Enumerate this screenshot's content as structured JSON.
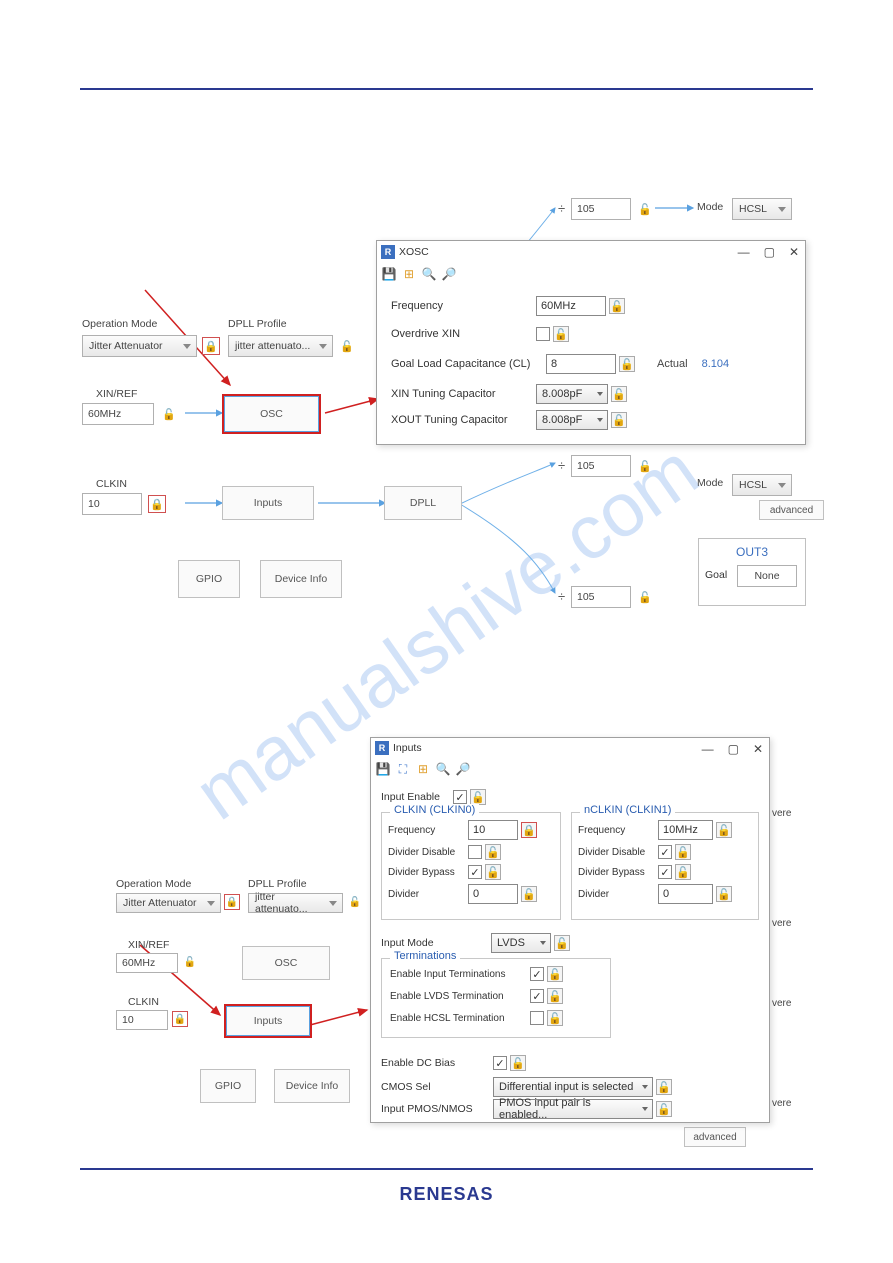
{
  "footer_logo": "RENESAS",
  "watermark": "manualshive.com",
  "diag1": {
    "op_mode_label": "Operation Mode",
    "op_mode_value": "Jitter Attenuator",
    "dpll_profile_label": "DPLL Profile",
    "dpll_profile_value": "jitter attenuato...",
    "xinref_label": "XIN/REF",
    "xinref_value": "60MHz",
    "clkin_label": "CLKIN",
    "clkin_value": "10",
    "osc": "OSC",
    "inputs": "Inputs",
    "dpll": "DPLL",
    "gpio": "GPIO",
    "devinfo": "Device Info",
    "div_sym": "÷",
    "div_val": "105",
    "mode_label": "Mode",
    "mode_value": "HCSL",
    "adv": "advanced",
    "out3": "OUT3",
    "goal": "Goal",
    "goal_val": "None"
  },
  "xosc": {
    "title": "XOSC",
    "freq_lbl": "Frequency",
    "freq_val": "60MHz",
    "over_lbl": "Overdrive XIN",
    "cl_lbl": "Goal Load Capacitance (CL)",
    "cl_val": "8",
    "actual_lbl": "Actual",
    "actual_val": "8.104",
    "xin_lbl": "XIN Tuning Capacitor",
    "xin_val": "8.008pF",
    "xout_lbl": "XOUT Tuning Capacitor",
    "xout_val": "8.008pF"
  },
  "diag2": {
    "op_mode_label": "Operation Mode",
    "op_mode_value": "Jitter Attenuator",
    "dpll_profile_label": "DPLL Profile",
    "dpll_profile_value": "jitter attenuato...",
    "xinref_label": "XIN/REF",
    "xinref_value": "60MHz",
    "clkin_label": "CLKIN",
    "clkin_value": "10",
    "osc": "OSC",
    "inputs": "Inputs",
    "gpio": "GPIO",
    "devinfo": "Device Info",
    "adv": "advanced",
    "vere": "vere"
  },
  "inputs_win": {
    "title": "Inputs",
    "enable_lbl": "Input Enable",
    "clk0_title": "CLKIN (CLKIN0)",
    "clk1_title": "nCLKIN (CLKIN1)",
    "freq_lbl": "Frequency",
    "clk0_freq": "10",
    "clk1_freq": "10MHz",
    "divdis_lbl": "Divider Disable",
    "divbyp_lbl": "Divider Bypass",
    "div_lbl": "Divider",
    "div_val": "0",
    "mode_lbl": "Input Mode",
    "mode_val": "LVDS",
    "term_title": "Terminations",
    "term_in": "Enable Input Terminations",
    "term_lvds": "Enable LVDS Termination",
    "term_hcsl": "Enable HCSL Termination",
    "dcbias": "Enable DC Bias",
    "cmos_lbl": "CMOS Sel",
    "cmos_val": "Differential input is selected",
    "pmos_lbl": "Input PMOS/NMOS",
    "pmos_val": "PMOS input pair is enabled..."
  }
}
